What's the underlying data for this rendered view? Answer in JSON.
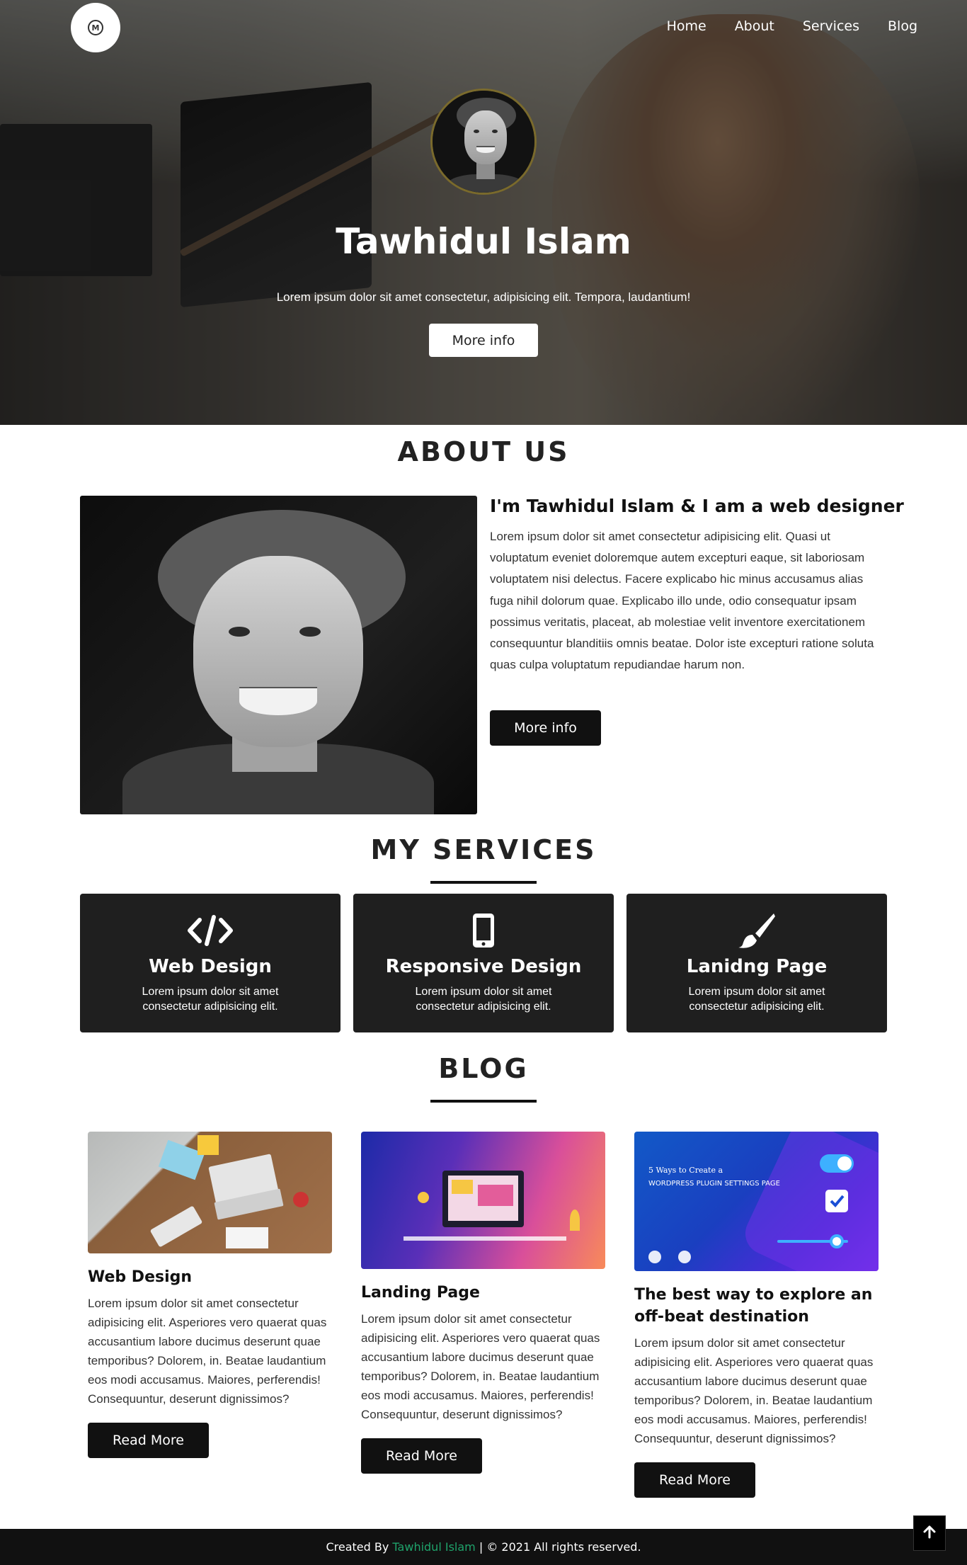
{
  "nav": {
    "logo_text": "M",
    "items": [
      {
        "label": "Home"
      },
      {
        "label": "About"
      },
      {
        "label": "Services"
      },
      {
        "label": "Blog"
      }
    ]
  },
  "hero": {
    "title": "Tawhidul Islam",
    "subtitle": "Lorem ipsum dolor sit amet consectetur, adipisicing elit. Tempora, laudantium!",
    "button": "More info"
  },
  "about": {
    "section_title": "ABOUT US",
    "heading": "I'm Tawhidul Islam & I am a web designer",
    "text": "Lorem ipsum dolor sit amet consectetur adipisicing elit. Quasi ut voluptatum eveniet doloremque autem excepturi eaque, sit laboriosam voluptatem nisi delectus. Facere explicabo hic minus accusamus alias fuga nihil dolorum quae. Explicabo illo unde, odio consequatur ipsam possimus veritatis, placeat, ab molestiae velit inventore exercitationem consequuntur blanditiis omnis beatae. Dolor iste excepturi ratione soluta quas culpa voluptatum repudiandae harum non.",
    "button": "More info"
  },
  "services": {
    "section_title": "MY SERVICES",
    "items": [
      {
        "icon": "code-icon",
        "title": "Web Design",
        "text": "Lorem ipsum dolor sit amet consectetur adipisicing elit."
      },
      {
        "icon": "mobile-icon",
        "title": "Responsive Design",
        "text": "Lorem ipsum dolor sit amet consectetur adipisicing elit."
      },
      {
        "icon": "paint-brush-icon",
        "title": "Lanidng Page",
        "text": "Lorem ipsum dolor sit amet consectetur adipisicing elit."
      }
    ]
  },
  "blog": {
    "section_title": "BLOG",
    "posts": [
      {
        "title": "Web Design",
        "text": "Lorem ipsum dolor sit amet consectetur adipisicing elit. Asperiores vero quaerat quas accusantium labore ducimus deserunt quae temporibus? Dolorem, in. Beatae laudantium eos modi accusamus. Maiores, perferendis! Consequuntur, deserunt dignissimos?",
        "button": "Read More"
      },
      {
        "title": "Landing Page",
        "text": "Lorem ipsum dolor sit amet consectetur adipisicing elit. Asperiores vero quaerat quas accusantium labore ducimus deserunt quae temporibus? Dolorem, in. Beatae laudantium eos modi accusamus. Maiores, perferendis! Consequuntur, deserunt dignissimos?",
        "button": "Read More"
      },
      {
        "title": "The best way to explore an off-beat destination",
        "text": "Lorem ipsum dolor sit amet consectetur adipisicing elit. Asperiores vero quaerat quas accusantium labore ducimus deserunt quae temporibus? Dolorem, in. Beatae laudantium eos modi accusamus. Maiores, perferendis! Consequuntur, deserunt dignissimos?",
        "button": "Read More",
        "image_caption_line1": "5 Ways to Create a",
        "image_caption_line2": "WORDPRESS PLUGIN SETTINGS PAGE"
      }
    ]
  },
  "footer": {
    "prefix": "Created By",
    "author": "Tawhidul Islam",
    "suffix": "| © 2021 All rights reserved."
  },
  "colors": {
    "dark": "#111111",
    "card": "#1f1f1f",
    "accent": "#1fa36b"
  }
}
